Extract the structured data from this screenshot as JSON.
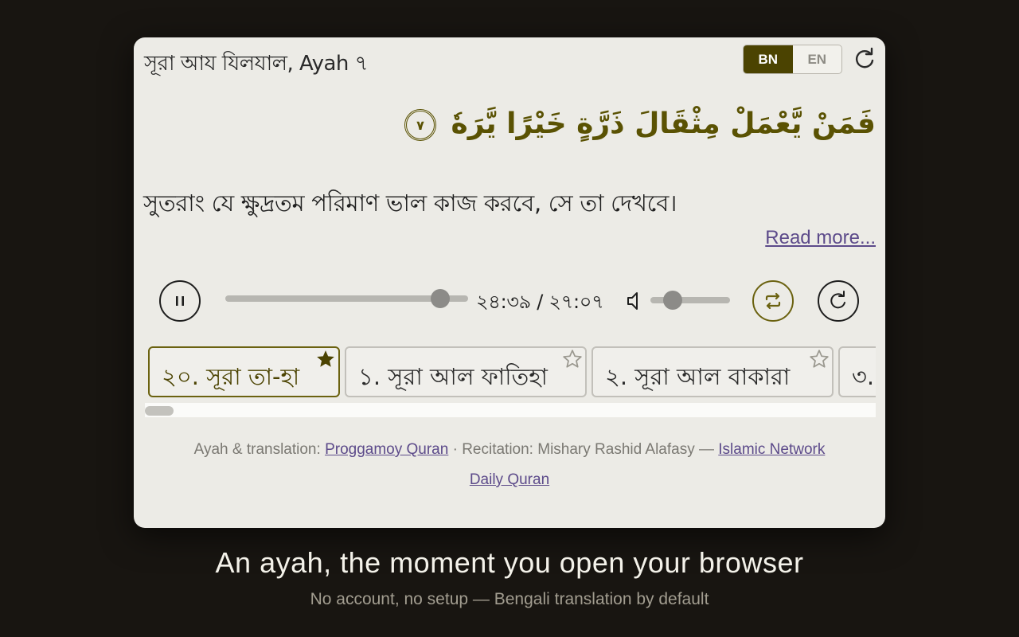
{
  "header": {
    "title": "সূরা আয যিলযাল, Ayah ৭",
    "lang_options": [
      "BN",
      "EN"
    ],
    "active_lang": "BN"
  },
  "ayah": {
    "arabic": "فَمَنْ يَّعْمَلْ مِثْقَالَ ذَرَّةٍ خَيْرًا يَّرَهٗ",
    "number": "٧",
    "translation": "সুতরাং যে ক্ষুদ্রতম পরিমাণ ভাল কাজ করবে, সে তা দেখবে।",
    "read_more": "Read more..."
  },
  "player": {
    "time": "২৪:৩৯ / ২৭:০৭",
    "progress": 0.885,
    "volume": 0.28,
    "state": "playing"
  },
  "surah_tabs": [
    {
      "label": "২০. সূরা তা-হা",
      "starred": true,
      "active": true
    },
    {
      "label": "১. সূরা আল ফাতিহা",
      "starred": false,
      "active": false
    },
    {
      "label": "২. সূরা আল বাকারা",
      "starred": false,
      "active": false
    },
    {
      "label": "৩.",
      "starred": false,
      "active": false
    }
  ],
  "attribution": {
    "ayah_prefix": "Ayah & translation: ",
    "ayah_link": "Proggamoy Quran",
    "recitation_prefix": " · Recitation: Mishary Rashid Alafasy — ",
    "recitation_link": "Islamic Network",
    "app_link": "Daily Quran"
  },
  "promo": {
    "headline": "An ayah, the moment you open your browser",
    "subline": "No account, no setup — Bengali translation by default"
  },
  "colors": {
    "accent": "#4b4301",
    "link": "#5c4a8a",
    "background": "#181511",
    "card": "#ecebe6"
  },
  "icons": {
    "refresh": "refresh-icon",
    "pause": "pause-icon",
    "volume": "volume-icon",
    "repeat": "repeat-icon",
    "replay": "replay-icon",
    "star": "star-icon"
  }
}
